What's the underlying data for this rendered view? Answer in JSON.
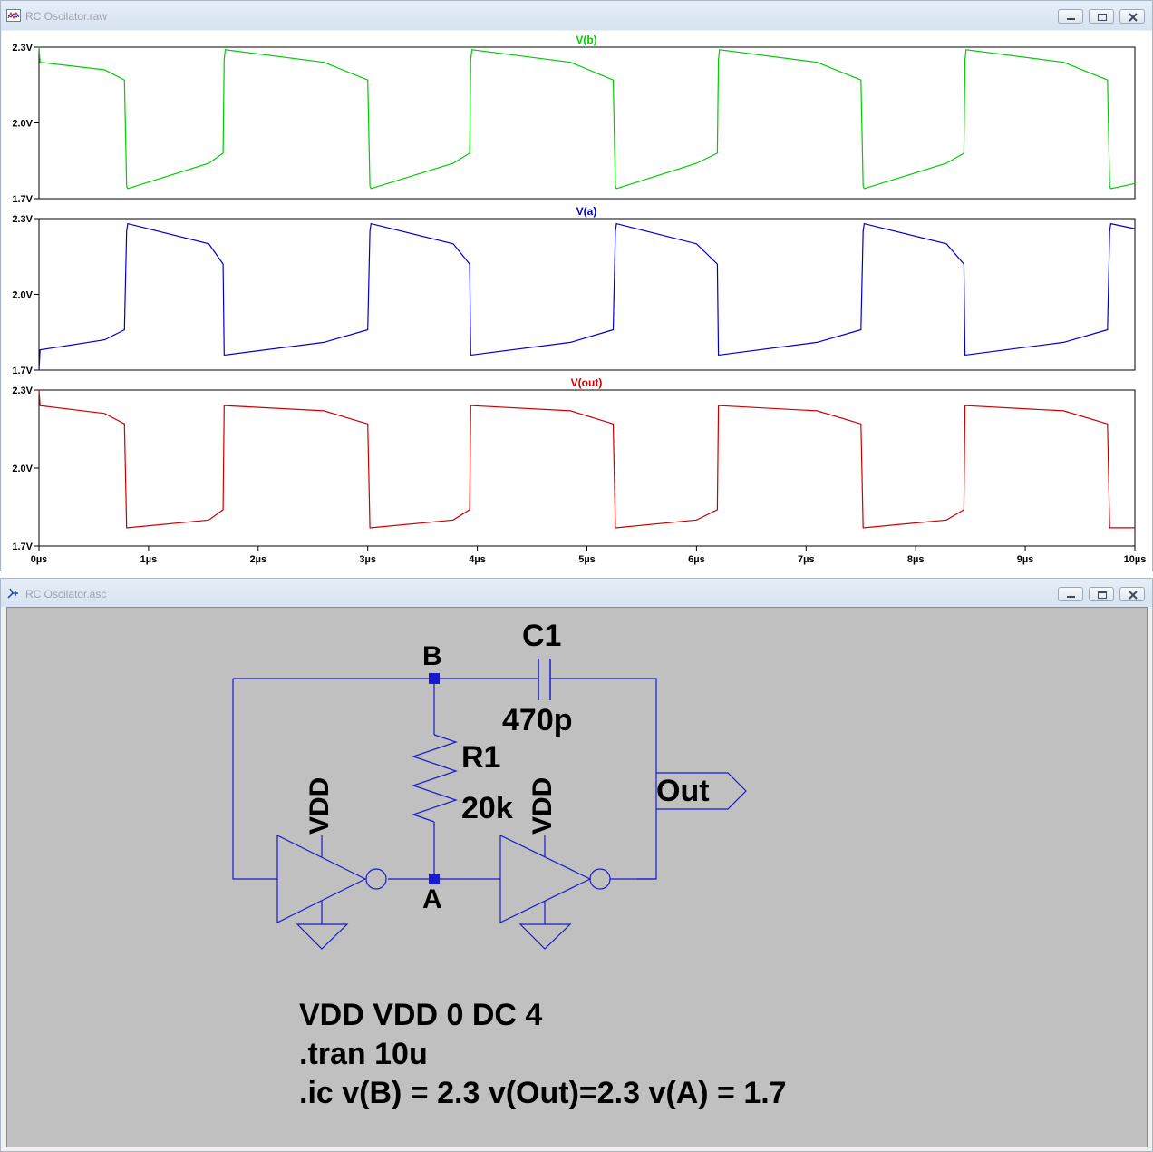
{
  "plot_window": {
    "title": "RC Oscilator.raw",
    "icon": "waveform-icon"
  },
  "schematic_window": {
    "title": "RC Oscilator.asc",
    "icon": "schematic-icon"
  },
  "chart_data": [
    {
      "type": "line",
      "title": "V(b)",
      "color": "#00cc00",
      "xlim": [
        0,
        10
      ],
      "ylim": [
        1.7,
        2.3
      ],
      "yticks": [
        "2.3V",
        "2.0V",
        "1.7V"
      ],
      "x": [
        0,
        0.01,
        0.6,
        0.78,
        0.8,
        0.81,
        1.55,
        1.68,
        1.69,
        1.7,
        2.6,
        3.0,
        3.02,
        3.03,
        3.78,
        3.93,
        3.94,
        3.95,
        4.85,
        5.24,
        5.26,
        5.27,
        6.0,
        6.19,
        6.2,
        6.21,
        7.1,
        7.5,
        7.52,
        7.53,
        8.28,
        8.44,
        8.45,
        8.46,
        9.35,
        9.75,
        9.77,
        9.78,
        10
      ],
      "series": [
        {
          "values": [
            2.3,
            2.24,
            2.21,
            2.17,
            1.75,
            1.74,
            1.84,
            1.88,
            2.25,
            2.29,
            2.24,
            2.17,
            1.75,
            1.74,
            1.84,
            1.88,
            2.25,
            2.29,
            2.24,
            2.17,
            1.75,
            1.74,
            1.84,
            1.88,
            2.25,
            2.29,
            2.24,
            2.17,
            1.75,
            1.74,
            1.84,
            1.88,
            2.25,
            2.29,
            2.24,
            2.17,
            1.75,
            1.74,
            1.76
          ]
        }
      ]
    },
    {
      "type": "line",
      "title": "V(a)",
      "color": "#0000cc",
      "xlim": [
        0,
        10
      ],
      "ylim": [
        1.7,
        2.3
      ],
      "yticks": [
        "2.3V",
        "2.0V",
        "1.7V"
      ],
      "x": [
        0,
        0.01,
        0.6,
        0.78,
        0.8,
        0.81,
        1.55,
        1.68,
        1.69,
        1.7,
        2.6,
        3.0,
        3.02,
        3.03,
        3.78,
        3.93,
        3.94,
        3.95,
        4.85,
        5.24,
        5.26,
        5.27,
        6.0,
        6.19,
        6.2,
        6.21,
        7.1,
        7.5,
        7.52,
        7.53,
        8.28,
        8.44,
        8.45,
        8.46,
        9.35,
        9.75,
        9.77,
        9.78,
        10
      ],
      "series": [
        {
          "values": [
            1.7,
            1.78,
            1.82,
            1.86,
            2.25,
            2.28,
            2.2,
            2.12,
            1.76,
            1.76,
            1.81,
            1.86,
            2.25,
            2.28,
            2.2,
            2.12,
            1.76,
            1.76,
            1.81,
            1.86,
            2.25,
            2.28,
            2.2,
            2.12,
            1.76,
            1.76,
            1.81,
            1.86,
            2.25,
            2.28,
            2.2,
            2.12,
            1.76,
            1.76,
            1.81,
            1.86,
            2.25,
            2.28,
            2.26
          ]
        }
      ]
    },
    {
      "type": "line",
      "title": "V(out)",
      "color": "#cc0000",
      "xlim": [
        0,
        10
      ],
      "ylim": [
        1.7,
        2.3
      ],
      "yticks": [
        "2.3V",
        "2.0V",
        "1.7V"
      ],
      "xticks": [
        "0µs",
        "1µs",
        "2µs",
        "3µs",
        "4µs",
        "5µs",
        "6µs",
        "7µs",
        "8µs",
        "9µs",
        "10µs"
      ],
      "x": [
        0,
        0.01,
        0.6,
        0.78,
        0.8,
        0.81,
        1.55,
        1.68,
        1.69,
        1.7,
        2.6,
        3.0,
        3.02,
        3.03,
        3.78,
        3.93,
        3.94,
        3.95,
        4.85,
        5.24,
        5.26,
        5.27,
        6.0,
        6.19,
        6.2,
        6.21,
        7.1,
        7.5,
        7.52,
        7.53,
        8.28,
        8.44,
        8.45,
        8.46,
        9.35,
        9.75,
        9.77,
        9.78,
        10
      ],
      "series": [
        {
          "values": [
            2.3,
            2.24,
            2.21,
            2.17,
            1.77,
            1.77,
            1.8,
            1.84,
            2.24,
            2.24,
            2.22,
            2.17,
            1.77,
            1.77,
            1.8,
            1.84,
            2.24,
            2.24,
            2.22,
            2.17,
            1.77,
            1.77,
            1.8,
            1.84,
            2.24,
            2.24,
            2.22,
            2.17,
            1.77,
            1.77,
            1.8,
            1.84,
            2.24,
            2.24,
            2.22,
            2.17,
            1.77,
            1.77,
            1.77
          ]
        }
      ]
    }
  ],
  "schematic": {
    "nodes": {
      "b": "B",
      "a": "A"
    },
    "c1": {
      "name": "C1",
      "value": "470p"
    },
    "r1": {
      "name": "R1",
      "value": "20k"
    },
    "vdd_label": "VDD",
    "out_label": "Out",
    "spice_lines": [
      "VDD VDD 0 DC 4",
      ".tran 10u",
      ".ic v(B) = 2.3 v(Out)=2.3 v(A)  = 1.7"
    ]
  }
}
